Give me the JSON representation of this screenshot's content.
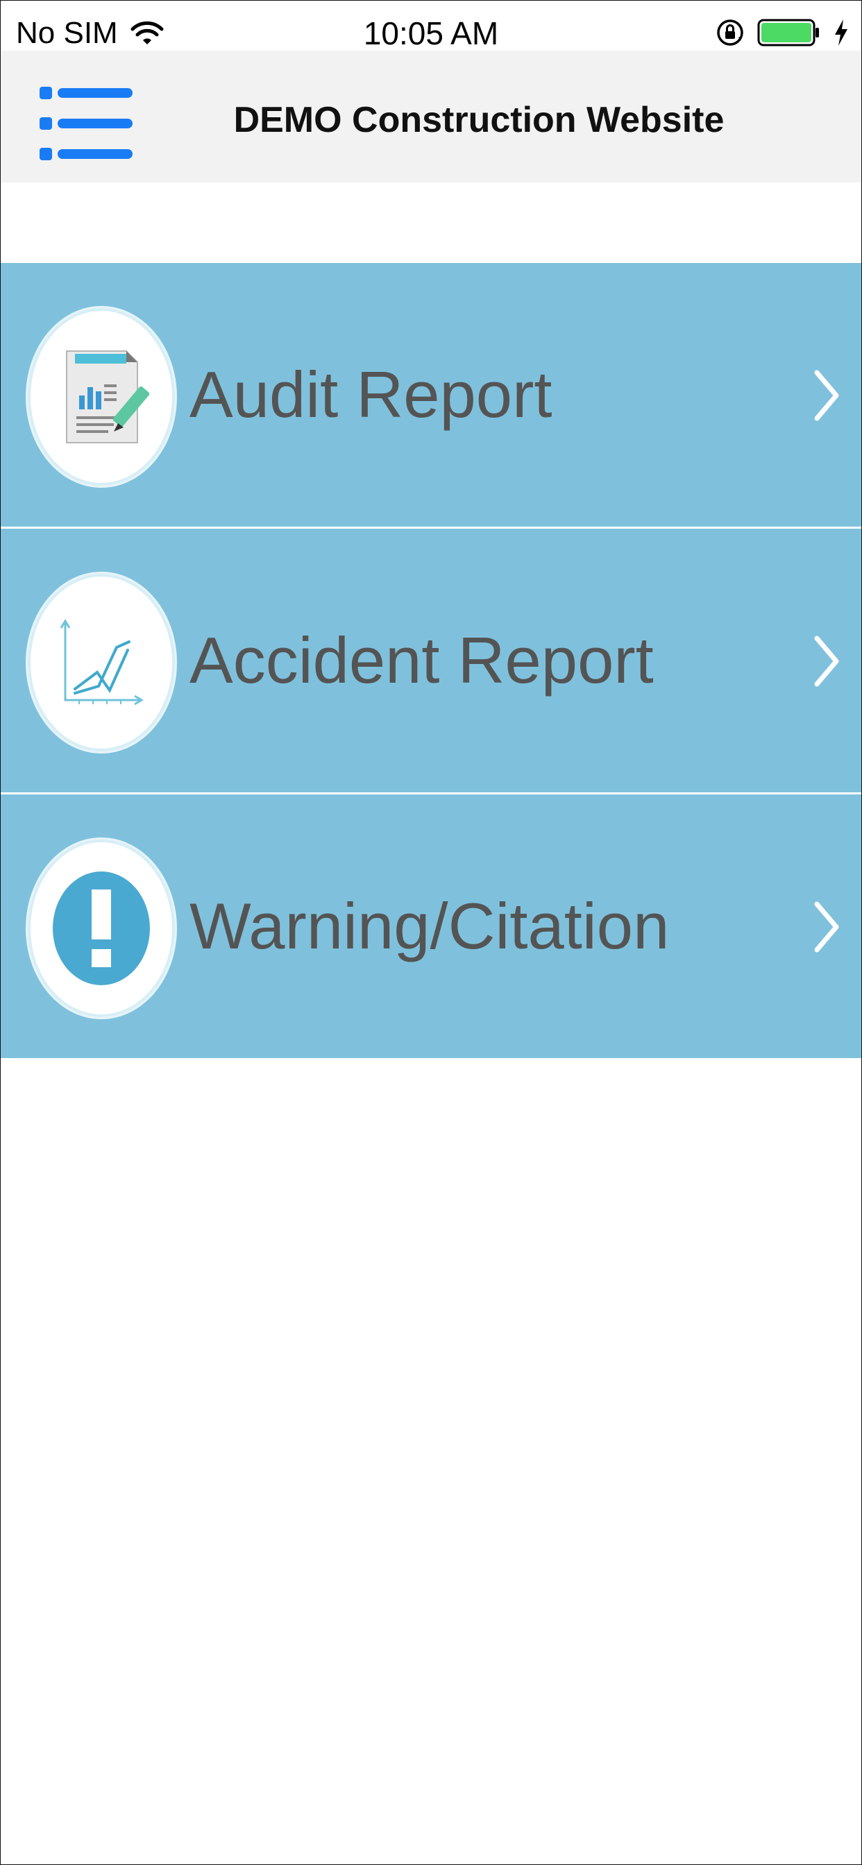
{
  "status_bar": {
    "carrier": "No SIM",
    "time": "10:05 AM",
    "icons": [
      "wifi-icon",
      "orientation-lock-icon",
      "battery-icon",
      "charging-bolt-icon"
    ]
  },
  "nav": {
    "title": "DEMO Construction Website",
    "menu_icon": "hamburger-menu-icon"
  },
  "menu": {
    "items": [
      {
        "label": "Audit Report",
        "icon": "audit-report-icon"
      },
      {
        "label": "Accident Report",
        "icon": "accident-chart-icon"
      },
      {
        "label": "Warning/Citation",
        "icon": "warning-exclamation-icon"
      }
    ]
  },
  "colors": {
    "row_background": "#7fc1dc",
    "nav_background": "#f2f2f2",
    "menu_icon_blue": "#1a7cf5",
    "label_text": "#545454",
    "battery_green": "#4cd964"
  }
}
